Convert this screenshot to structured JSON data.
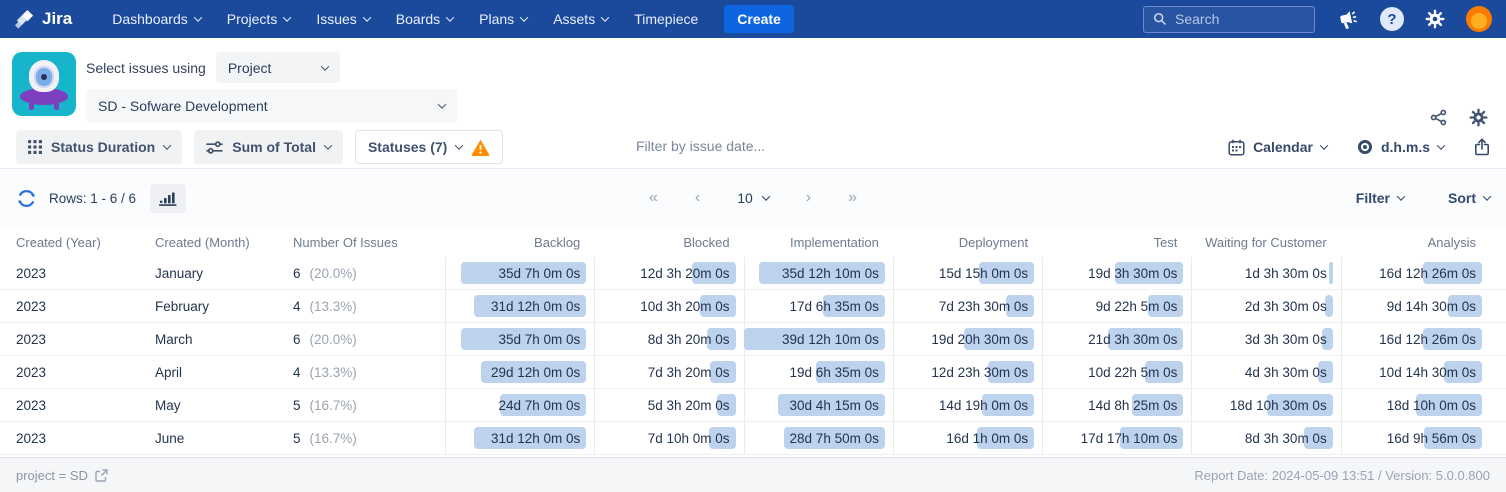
{
  "nav": {
    "logo_text": "Jira",
    "items": [
      {
        "label": "Dashboards",
        "chevron": true
      },
      {
        "label": "Projects",
        "chevron": true
      },
      {
        "label": "Issues",
        "chevron": true
      },
      {
        "label": "Boards",
        "chevron": true
      },
      {
        "label": "Plans",
        "chevron": true
      },
      {
        "label": "Assets",
        "chevron": true
      },
      {
        "label": "Timepiece",
        "chevron": false
      }
    ],
    "create_label": "Create",
    "search_placeholder": "Search"
  },
  "header": {
    "select_issues_label": "Select issues using",
    "issue_source_value": "Project",
    "project_value": "SD - Sofware Development"
  },
  "toolbar": {
    "report_type_label": "Status Duration",
    "aggregation_label": "Sum of Total",
    "statuses_label": "Statuses (7)",
    "date_filter_placeholder": "Filter by issue date...",
    "calendar_label": "Calendar",
    "time_format_label": "d.h.m.s"
  },
  "pager": {
    "rows_label": "Rows: 1 - 6 / 6",
    "first_symbol": "«",
    "prev_symbol": "‹",
    "page_size": "10",
    "next_symbol": "›",
    "last_symbol": "»",
    "filter_label": "Filter",
    "sort_label": "Sort"
  },
  "table": {
    "columns": [
      "Created (Year)",
      "Created (Month)",
      "Number Of Issues",
      "Backlog",
      "Blocked",
      "Implementation",
      "Deployment",
      "Test",
      "Waiting for Customer",
      "Analysis"
    ],
    "rows": [
      {
        "year": "2023",
        "month": "January",
        "issues": "6",
        "percent": "(20.0%)",
        "durations": [
          "35d 7h 0m 0s",
          "12d 3h 20m 0s",
          "35d 12h 10m 0s",
          "15d 15h 0m 0s",
          "19d 3h 30m 0s",
          "1d 3h 30m 0s",
          "16d 12h 26m 0s"
        ]
      },
      {
        "year": "2023",
        "month": "February",
        "issues": "4",
        "percent": "(13.3%)",
        "durations": [
          "31d 12h 0m 0s",
          "10d 3h 20m 0s",
          "17d 6h 35m 0s",
          "7d 23h 30m 0s",
          "9d 22h 5m 0s",
          "2d 3h 30m 0s",
          "9d 14h 30m 0s"
        ]
      },
      {
        "year": "2023",
        "month": "March",
        "issues": "6",
        "percent": "(20.0%)",
        "durations": [
          "35d 7h 0m 0s",
          "8d 3h 20m 0s",
          "39d 12h 10m 0s",
          "19d 20h 30m 0s",
          "21d 3h 30m 0s",
          "3d 3h 30m 0s",
          "16d 12h 26m 0s"
        ]
      },
      {
        "year": "2023",
        "month": "April",
        "issues": "4",
        "percent": "(13.3%)",
        "durations": [
          "29d 12h 0m 0s",
          "7d 3h 20m 0s",
          "19d 6h 35m 0s",
          "12d 23h 30m 0s",
          "10d 22h 5m 0s",
          "4d 3h 30m 0s",
          "10d 14h 30m 0s"
        ]
      },
      {
        "year": "2023",
        "month": "May",
        "issues": "5",
        "percent": "(16.7%)",
        "durations": [
          "24d 7h 0m 0s",
          "5d 3h 20m 0s",
          "30d 4h 15m 0s",
          "14d 19h 0m 0s",
          "14d 8h 25m 0s",
          "18d 10h 30m 0s",
          "18d 10h 0m 0s"
        ]
      },
      {
        "year": "2023",
        "month": "June",
        "issues": "5",
        "percent": "(16.7%)",
        "durations": [
          "31d 12h 0m 0s",
          "7d 10h 0m 0s",
          "28d 7h 50m 0s",
          "16d 1h 0m 0s",
          "17d 17h 10m 0s",
          "8d 3h 30m 0s",
          "16d 9h 56m 0s"
        ]
      }
    ]
  },
  "footer": {
    "query_text": "project = SD",
    "report_info": "Report Date: 2024-05-09 13:51 / Version: 5.0.0.800"
  },
  "colors": {
    "nav_bg": "#1b4a9c",
    "create_button": "#0d66e0",
    "duration_bar": "#bdd2ec",
    "warning": "#ff8b00",
    "refresh_accent": "#2d6ee0",
    "app_icon_teal": "#16b5cb"
  }
}
